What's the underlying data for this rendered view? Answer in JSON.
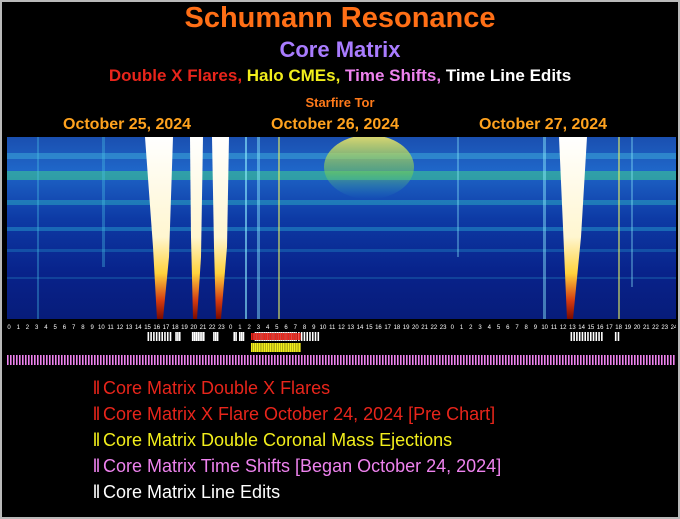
{
  "header": {
    "title": "Schumann Resonance",
    "subtitle": "Core Matrix",
    "legend": [
      {
        "text": "Double X Flares,",
        "color": "#e8251b"
      },
      {
        "text": "Halo CMEs,",
        "color": "#f2ee1c"
      },
      {
        "text": "Time Shifts,",
        "color": "#ee82ee"
      },
      {
        "text": "Time Line Edits",
        "color": "#ffffff"
      }
    ],
    "source": "Starfire Tor",
    "title_color": "#ff6f16",
    "subtitle_color": "#a97cff",
    "source_color": "#ff7a1a"
  },
  "dates": [
    "October 25, 2024",
    "October 26, 2024",
    "October 27, 2024"
  ],
  "date_color": "#ffa21e",
  "hour_axis": {
    "labels": [
      "0",
      "1",
      "2",
      "3",
      "4",
      "5",
      "6",
      "7",
      "8",
      "9",
      "10",
      "11",
      "12",
      "13",
      "14",
      "15",
      "16",
      "17",
      "18",
      "19",
      "20",
      "21",
      "22",
      "23",
      "0",
      "1",
      "2",
      "3",
      "4",
      "5",
      "6",
      "7",
      "8",
      "9",
      "10",
      "11",
      "12",
      "13",
      "14",
      "15",
      "16",
      "17",
      "18",
      "19",
      "20",
      "21",
      "22",
      "23",
      "0",
      "1",
      "2",
      "3",
      "4",
      "5",
      "6",
      "7",
      "8",
      "9",
      "10",
      "11",
      "12",
      "13",
      "14",
      "15",
      "16",
      "17",
      "18",
      "19",
      "20",
      "21",
      "22",
      "23",
      "24"
    ]
  },
  "events": {
    "time_line_edits": {
      "color": "#ffffff",
      "hours": [
        15,
        15.3,
        15.6,
        15.9,
        16.2,
        16.5,
        16.8,
        17.1,
        17.4,
        18,
        18.2,
        18.4,
        19.8,
        20,
        20.2,
        20.4,
        20.6,
        20.8,
        21,
        22.1,
        22.3,
        22.5,
        24.3,
        24.5,
        24.9,
        25.1,
        25.3,
        26.6,
        26.8,
        27.0,
        27.2,
        27.4,
        27.6,
        27.8,
        28.0,
        28.2,
        28.4,
        28.6,
        28.8,
        29.0,
        29.2,
        29.4,
        29.6,
        29.8,
        30.0,
        30.2,
        30.4,
        30.6,
        30.8,
        31,
        31.3,
        31.6,
        31.9,
        32.2,
        32.5,
        32.8,
        33.1,
        33.4,
        60.8,
        61.1,
        61.4,
        61.7,
        62,
        62.3,
        62.6,
        62.9,
        63.2,
        63.5,
        63.8,
        64.1,
        65.6,
        65.9
      ]
    },
    "double_x_flares": {
      "color": "#e8251b",
      "hours": [
        26.2,
        26.4,
        26.6,
        26.8,
        27,
        27.2,
        27.4,
        27.6,
        27.8,
        28,
        28.2,
        28.4,
        28.6,
        28.8,
        29,
        29.2,
        29.4,
        29.6,
        29.8,
        30,
        30.2,
        30.4,
        30.6,
        30.8,
        31,
        31.2,
        31.4
      ]
    },
    "coronal_mass_ejections": {
      "color": "#f2ee1c",
      "hours": [
        26.2,
        26.4,
        26.6,
        26.8,
        27,
        27.2,
        27.4,
        27.6,
        27.8,
        28,
        28.2,
        28.4,
        28.6,
        28.8,
        29,
        29.2,
        29.4,
        29.6,
        29.8,
        30,
        30.2,
        30.4,
        30.6,
        30.8,
        31,
        31.2,
        31.4
      ]
    },
    "time_shifts": {
      "color": "#ee82ee",
      "span_hours": [
        0,
        72
      ]
    }
  },
  "key": [
    {
      "label": "Core Matrix Double X Flares",
      "color": "#e8251b"
    },
    {
      "label": "Core Matrix X Flare October 24, 2024 [Pre Chart]",
      "color": "#e8251b"
    },
    {
      "label": "Core Matrix Double Coronal Mass Ejections",
      "color": "#f2ee1c"
    },
    {
      "label": "Core Matrix Time Shifts [Began October 24, 2024]",
      "color": "#ee82ee"
    },
    {
      "label": "Core Matrix Line Edits",
      "color": "#ffffff"
    }
  ],
  "key_marker": "ll"
}
